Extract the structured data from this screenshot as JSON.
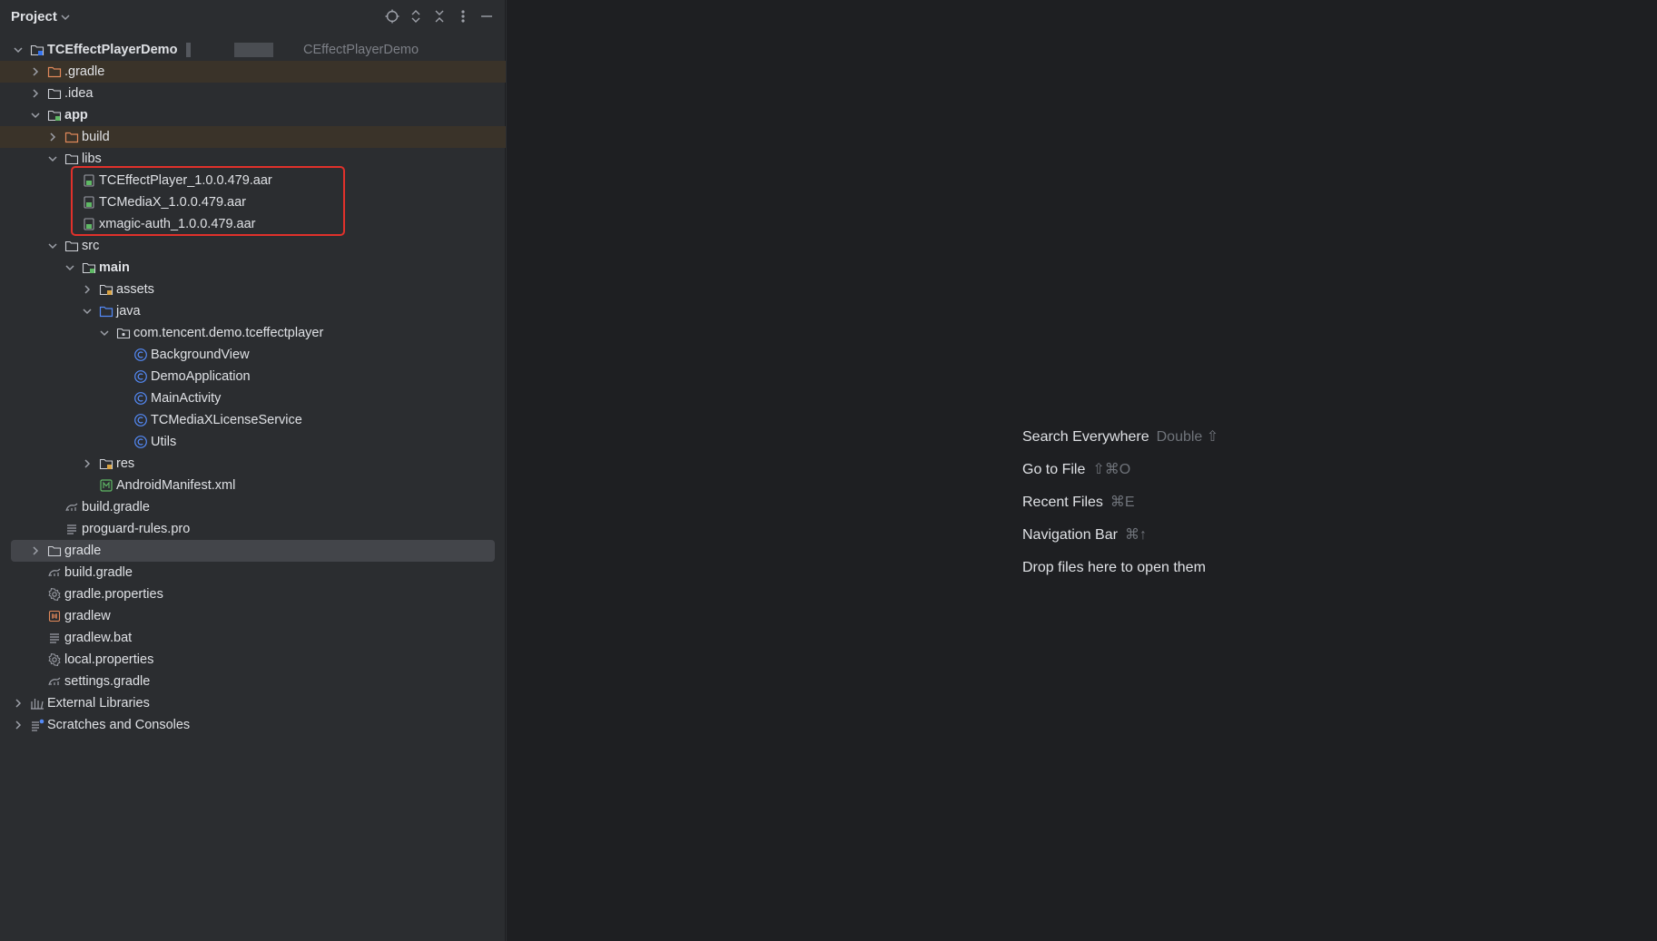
{
  "panel": {
    "title": "Project",
    "tools": [
      "locate-icon",
      "expand-collapse-icon",
      "collapse-all-icon",
      "more-options-icon",
      "minimize-icon"
    ]
  },
  "tree": {
    "root_name": "TCEffectPlayerDemo",
    "root_path": "CEffectPlayerDemo",
    "gradle_hidden": ".gradle",
    "idea": ".idea",
    "app": "app",
    "build": "build",
    "libs": "libs",
    "libs_files": [
      "TCEffectPlayer_1.0.0.479.aar",
      "TCMediaX_1.0.0.479.aar",
      "xmagic-auth_1.0.0.479.aar"
    ],
    "src": "src",
    "main": "main",
    "assets": "assets",
    "java": "java",
    "package": "com.tencent.demo.tceffectplayer",
    "classes": [
      "BackgroundView",
      "DemoApplication",
      "MainActivity",
      "TCMediaXLicenseService",
      "Utils"
    ],
    "res": "res",
    "manifest": "AndroidManifest.xml",
    "app_build_gradle": "build.gradle",
    "proguard": "proguard-rules.pro",
    "gradle_dir": "gradle",
    "root_build_gradle": "build.gradle",
    "gradle_properties": "gradle.properties",
    "gradlew": "gradlew",
    "gradlew_bat": "gradlew.bat",
    "local_properties": "local.properties",
    "settings_gradle": "settings.gradle",
    "external_libraries": "External Libraries",
    "scratches": "Scratches and Consoles"
  },
  "editor": {
    "hints": [
      {
        "label": "Search Everywhere",
        "shortcut": "Double ⇧"
      },
      {
        "label": "Go to File",
        "shortcut": "⇧⌘O"
      },
      {
        "label": "Recent Files",
        "shortcut": "⌘E"
      },
      {
        "label": "Navigation Bar",
        "shortcut": "⌘↑"
      },
      {
        "label": "Drop files here to open them",
        "shortcut": ""
      }
    ]
  },
  "colors": {
    "panel_bg": "#2b2d30",
    "editor_bg": "#1e1f22",
    "highlight_border": "#e0312b",
    "build_folder_bg": "#3a3329",
    "selection_bg": "#43454a"
  }
}
